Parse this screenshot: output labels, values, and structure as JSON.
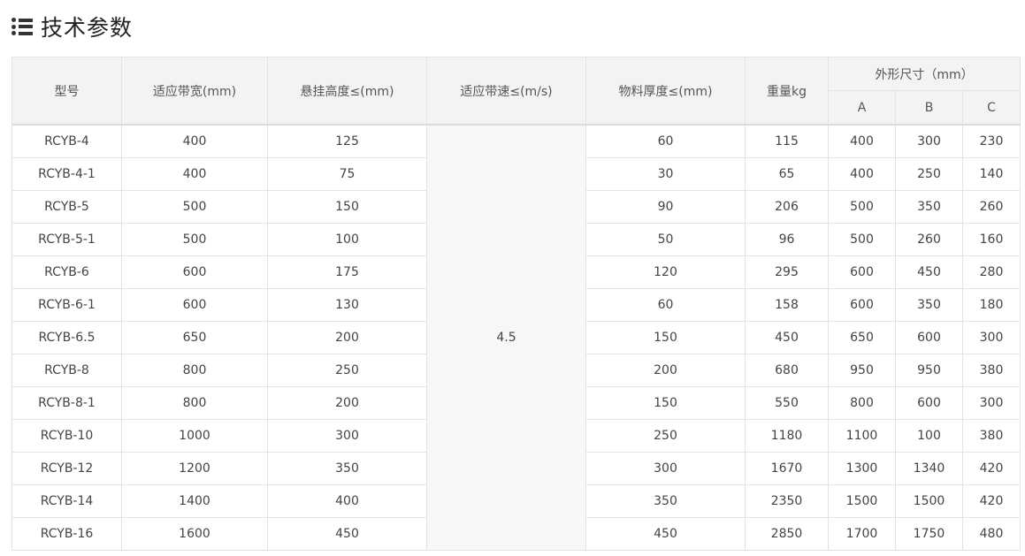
{
  "page": {
    "title": "技术参数",
    "icon": "list-icon"
  },
  "table": {
    "headers": {
      "model": "型号",
      "belt_width": "适应带宽(mm)",
      "hang_height": "悬挂高度≤(mm)",
      "belt_speed": "适应带速≤(m/s)",
      "thickness": "物料厚度≤(mm)",
      "weight": "重量kg",
      "dimensions": "外形尺寸（mm）",
      "dim_a": "A",
      "dim_b": "B",
      "dim_c": "C"
    },
    "belt_speed_value": "4.5",
    "rows": [
      {
        "model": "RCYB-4",
        "width": "400",
        "height": "125",
        "thickness": "60",
        "weight": "115",
        "a": "400",
        "b": "300",
        "c": "230"
      },
      {
        "model": "RCYB-4-1",
        "width": "400",
        "height": "75",
        "thickness": "30",
        "weight": "65",
        "a": "400",
        "b": "250",
        "c": "140"
      },
      {
        "model": "RCYB-5",
        "width": "500",
        "height": "150",
        "thickness": "90",
        "weight": "206",
        "a": "500",
        "b": "350",
        "c": "260"
      },
      {
        "model": "RCYB-5-1",
        "width": "500",
        "height": "100",
        "thickness": "50",
        "weight": "96",
        "a": "500",
        "b": "260",
        "c": "160"
      },
      {
        "model": "RCYB-6",
        "width": "600",
        "height": "175",
        "thickness": "120",
        "weight": "295",
        "a": "600",
        "b": "450",
        "c": "280"
      },
      {
        "model": "RCYB-6-1",
        "width": "600",
        "height": "130",
        "thickness": "60",
        "weight": "158",
        "a": "600",
        "b": "350",
        "c": "180"
      },
      {
        "model": "RCYB-6.5",
        "width": "650",
        "height": "200",
        "thickness": "150",
        "weight": "450",
        "a": "650",
        "b": "600",
        "c": "300"
      },
      {
        "model": "RCYB-8",
        "width": "800",
        "height": "250",
        "thickness": "200",
        "weight": "680",
        "a": "950",
        "b": "950",
        "c": "380"
      },
      {
        "model": "RCYB-8-1",
        "width": "800",
        "height": "200",
        "thickness": "150",
        "weight": "550",
        "a": "800",
        "b": "600",
        "c": "300"
      },
      {
        "model": "RCYB-10",
        "width": "1000",
        "height": "300",
        "thickness": "250",
        "weight": "1180",
        "a": "1100",
        "b": "100",
        "c": "380"
      },
      {
        "model": "RCYB-12",
        "width": "1200",
        "height": "350",
        "thickness": "300",
        "weight": "1670",
        "a": "1300",
        "b": "1340",
        "c": "420"
      },
      {
        "model": "RCYB-14",
        "width": "1400",
        "height": "400",
        "thickness": "350",
        "weight": "2350",
        "a": "1500",
        "b": "1500",
        "c": "420"
      },
      {
        "model": "RCYB-16",
        "width": "1600",
        "height": "450",
        "thickness": "450",
        "weight": "2850",
        "a": "1700",
        "b": "1750",
        "c": "480"
      }
    ]
  }
}
